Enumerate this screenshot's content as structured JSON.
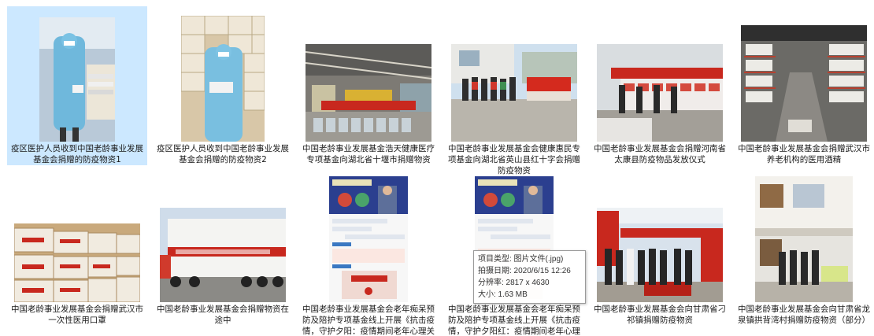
{
  "files": [
    {
      "caption": "疫区医护人员收到中国老龄事业发展基金会捐赠的防疫物资1",
      "selected": true
    },
    {
      "caption": "疫区医护人员收到中国老龄事业发展基金会捐赠的防疫物资2",
      "selected": false
    },
    {
      "caption": "中国老龄事业发展基金浩天健康医疗专项基金向湖北省十堰市捐赠物资",
      "selected": false
    },
    {
      "caption": "中国老龄事业发展基金会健康惠民专项基金向湖北省英山县红十字会捐赠防疫物资",
      "selected": false
    },
    {
      "caption": "中国老龄事业发展基金会捐赠河南省太康县防疫物品发放仪式",
      "selected": false
    },
    {
      "caption": "中国老龄事业发展基金会捐赠武汉市养老机构的医用酒精",
      "selected": false
    },
    {
      "caption": "中国老龄事业发展基金会捐赠武汉市一次性医用口罩",
      "selected": false
    },
    {
      "caption": "中国老龄事业发展基金会捐赠物资在途中",
      "selected": false
    },
    {
      "caption": "中国老龄事业发展基金会老年痴呆预防及陪护专项基金线上开展《抗击疫情，守护夕阳：疫情期间老年心理关爱》直",
      "selected": false
    },
    {
      "caption": "中国老龄事业发展基金会老年痴呆预防及陪护专项基金线上开展《抗击疫情，守护夕阳红：疫情期间老年心理关爱》",
      "selected": false
    },
    {
      "caption": "中国老龄事业发展基金会向甘肃省刁祁镇捐赠防疫物资",
      "selected": false
    },
    {
      "caption": "中国老龄事业发展基金会向甘肃省龙泉镇拱背湾村捐赠防疫物资（部分）",
      "selected": false
    }
  ],
  "tooltip": {
    "type": "项目类型: 图片文件(.jpg)",
    "date": "拍摄日期: 2020/6/15 12:26",
    "resolution": "分辨率: 2817 x 4630",
    "size": "大小: 1.63 MB"
  },
  "colors": {
    "selection": "#cce8ff",
    "banner_red": "#c8281e",
    "sky": "#cfe0ee"
  }
}
